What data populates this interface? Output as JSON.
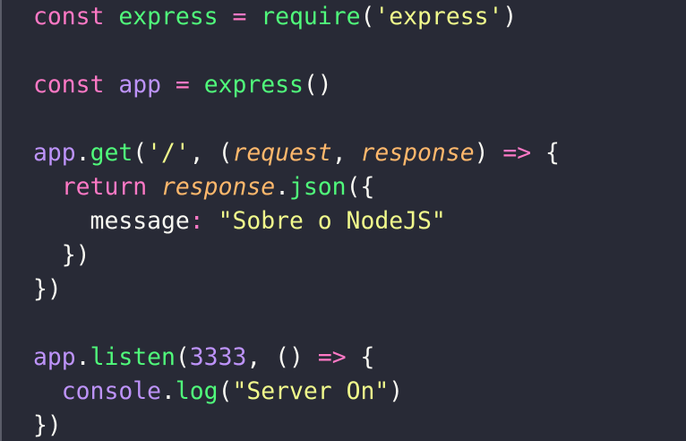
{
  "editor": {
    "theme": "dark",
    "background": "#282a36",
    "colors": {
      "keyword": "#ff79c6",
      "function": "#50fa7b",
      "variable": "#bd93f9",
      "string": "#f1fa8c",
      "parameter": "#ffb86c",
      "plain": "#f8f8f2"
    },
    "lines": [
      [
        [
          "kw",
          "const"
        ],
        [
          "pl",
          " "
        ],
        [
          "id",
          "express"
        ],
        [
          "pl",
          " "
        ],
        [
          "op",
          "="
        ],
        [
          "pl",
          " "
        ],
        [
          "fn",
          "require"
        ],
        [
          "pl",
          "("
        ],
        [
          "st",
          "'express'"
        ],
        [
          "pl",
          ")"
        ]
      ],
      [],
      [
        [
          "kw",
          "const"
        ],
        [
          "pl",
          " "
        ],
        [
          "vr",
          "app"
        ],
        [
          "pl",
          " "
        ],
        [
          "op",
          "="
        ],
        [
          "pl",
          " "
        ],
        [
          "fn",
          "express"
        ],
        [
          "pl",
          "()"
        ]
      ],
      [],
      [
        [
          "vr",
          "app"
        ],
        [
          "pl",
          "."
        ],
        [
          "fn",
          "get"
        ],
        [
          "pl",
          "("
        ],
        [
          "st",
          "'/'"
        ],
        [
          "pl",
          ", ("
        ],
        [
          "pr",
          "request"
        ],
        [
          "pl",
          ", "
        ],
        [
          "pr",
          "response"
        ],
        [
          "pl",
          ") "
        ],
        [
          "op",
          "=>"
        ],
        [
          "pl",
          " {"
        ]
      ],
      [
        [
          "pl",
          "  "
        ],
        [
          "kw",
          "return"
        ],
        [
          "pl",
          " "
        ],
        [
          "pr",
          "response"
        ],
        [
          "pl",
          "."
        ],
        [
          "fn",
          "json"
        ],
        [
          "pl",
          "({"
        ]
      ],
      [
        [
          "pl",
          "    message"
        ],
        [
          "op",
          ":"
        ],
        [
          "pl",
          " "
        ],
        [
          "st",
          "\"Sobre o NodeJS\""
        ]
      ],
      [
        [
          "pl",
          "  })"
        ]
      ],
      [
        [
          "pl",
          "})"
        ]
      ],
      [],
      [
        [
          "vr",
          "app"
        ],
        [
          "pl",
          "."
        ],
        [
          "fn",
          "listen"
        ],
        [
          "pl",
          "("
        ],
        [
          "nm",
          "3333"
        ],
        [
          "pl",
          ", () "
        ],
        [
          "op",
          "=>"
        ],
        [
          "pl",
          " {"
        ]
      ],
      [
        [
          "pl",
          "  "
        ],
        [
          "vr",
          "console"
        ],
        [
          "pl",
          "."
        ],
        [
          "fn",
          "log"
        ],
        [
          "pl",
          "("
        ],
        [
          "st",
          "\"Server On\""
        ],
        [
          "pl",
          ")"
        ]
      ],
      [
        [
          "pl",
          "})"
        ]
      ]
    ]
  }
}
